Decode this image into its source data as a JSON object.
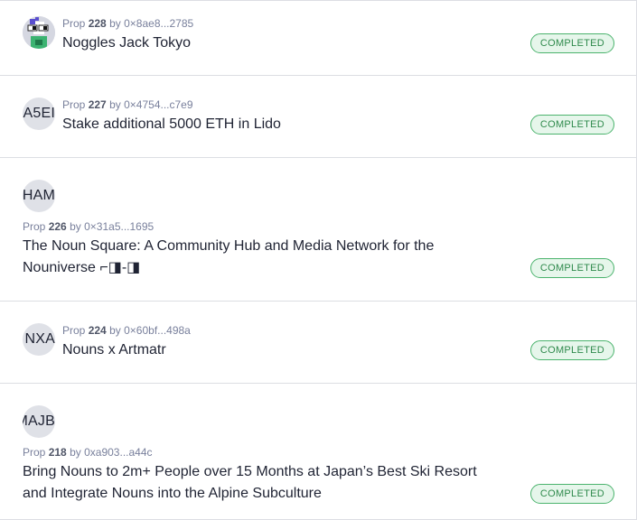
{
  "proposals": [
    {
      "prop_word": "Prop",
      "number": "228",
      "by": "by",
      "proposer": "0×8ae8...2785",
      "title": "Noggles Jack Tokyo",
      "status": "COMPLETED",
      "avatar_type": "noun-image",
      "avatar_text": ""
    },
    {
      "prop_word": "Prop",
      "number": "227",
      "by": "by",
      "proposer": "0×4754...c7e9",
      "title": "Stake additional 5000 ETH in Lido",
      "status": "COMPLETED",
      "avatar_type": "text",
      "avatar_text": "A5EI"
    },
    {
      "prop_word": "Prop",
      "number": "226",
      "by": "by",
      "proposer": "0×31a5...1695",
      "title_line1": "The Noun Square: A Community Hub and Media Network for the",
      "title_line2": "Nouniverse ⌐◨-◨",
      "status": "COMPLETED",
      "avatar_type": "text",
      "avatar_text": "HAM"
    },
    {
      "prop_word": "Prop",
      "number": "224",
      "by": "by",
      "proposer": "0×60bf...498a",
      "title": "Nouns x Artmatr",
      "status": "COMPLETED",
      "avatar_type": "text",
      "avatar_text": "NXA"
    },
    {
      "prop_word": "Prop",
      "number": "218",
      "by": "by",
      "proposer": "0xa903...a44c",
      "title_line1": "Bring Nouns to 2m+ People over 15 Months at Japan’s Best Ski Resort",
      "title_line2": "and Integrate Nouns into the Alpine Subculture",
      "status": "COMPLETED",
      "avatar_type": "text",
      "avatar_text": "MAJB"
    }
  ],
  "colors": {
    "badge_border": "#4bb36d",
    "badge_bg": "#e6f6eb",
    "badge_text": "#2f8a4c",
    "avatar_bg": "#dfe1e7",
    "divider": "#dcdee3"
  }
}
